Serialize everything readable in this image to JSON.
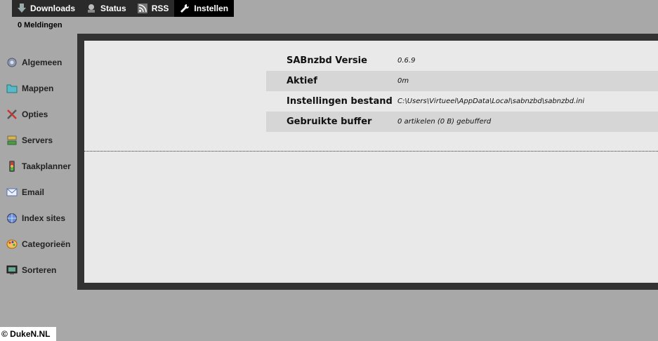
{
  "nav": {
    "items": [
      {
        "label": "Downloads",
        "icon": "download-icon"
      },
      {
        "label": "Status",
        "icon": "status-icon"
      },
      {
        "label": "RSS",
        "icon": "rss-icon"
      },
      {
        "label": "Instellen",
        "icon": "wrench-icon"
      }
    ],
    "active": "Instellen"
  },
  "notifications": "0 Meldingen",
  "sidebar": {
    "items": [
      {
        "label": "Algemeen",
        "icon": "gear-icon"
      },
      {
        "label": "Mappen",
        "icon": "folder-icon"
      },
      {
        "label": "Opties",
        "icon": "tools-icon"
      },
      {
        "label": "Servers",
        "icon": "server-icon"
      },
      {
        "label": "Taakplanner",
        "icon": "scheduler-icon"
      },
      {
        "label": "Email",
        "icon": "email-icon"
      },
      {
        "label": "Index sites",
        "icon": "globe-icon"
      },
      {
        "label": "Categorieën",
        "icon": "palette-icon"
      },
      {
        "label": "Sorteren",
        "icon": "sort-icon"
      }
    ]
  },
  "info": {
    "rows": [
      {
        "key": "SABnzbd Versie",
        "value": "0.6.9"
      },
      {
        "key": "Aktief",
        "value": "0m"
      },
      {
        "key": "Instellingen bestand",
        "value": "C:\\Users\\Virtueel\\AppData\\Local\\sabnzbd\\sabnzbd.ini"
      },
      {
        "key": "Gebruikte buffer",
        "value": "0 artikelen (0 B) gebufferd"
      }
    ]
  },
  "copyright": "© DukeN.NL"
}
